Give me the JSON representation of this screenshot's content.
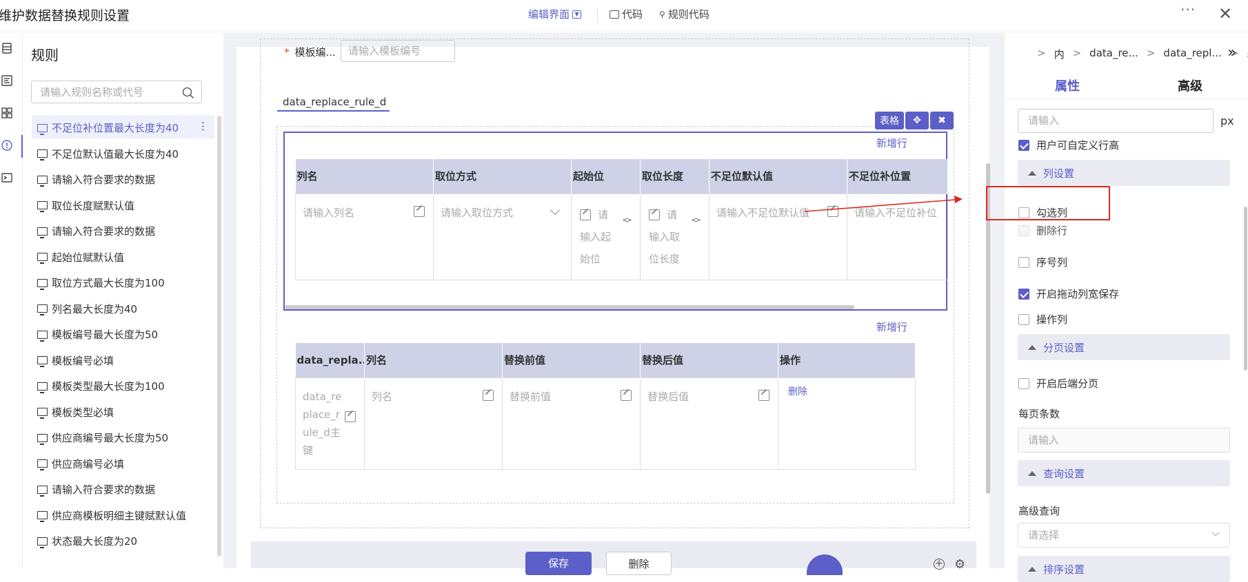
{
  "app": {
    "title": "维护数据替换规则设置",
    "nav": {
      "edit_ui": "编辑界面",
      "code": "代码",
      "rule_code": "规则代码"
    }
  },
  "rules_panel": {
    "title": "规则",
    "search_placeholder": "请输入规则名称或代号",
    "items": [
      "不足位补位置最大长度为40",
      "不足位默认值最大长度为40",
      "请输入符合要求的数据",
      "取位长度赋默认值",
      "请输入符合要求的数据",
      "起始位赋默认值",
      "取位方式最大长度为100",
      "列名最大长度为40",
      "模板编号最大长度为50",
      "模板编号必填",
      "模板类型最大长度为100",
      "模板类型必填",
      "供应商编号最大长度为50",
      "供应商编号必填",
      "请输入符合要求的数据",
      "供应商模板明细主键赋默认值",
      "状态最大长度为20"
    ],
    "selected_index": 0
  },
  "form": {
    "template_no_label": "模板编...",
    "template_no_placeholder": "请输入模板编号",
    "required_mark": "*",
    "tab_label": "data_replace_rule_d"
  },
  "widget_tags": {
    "table": "表格",
    "move": "✥",
    "close": "✖"
  },
  "table1": {
    "add_row": "新增行",
    "headers": [
      "列名",
      "取位方式",
      "起始位",
      "取位长度",
      "不足位默认值",
      "不足位补位置"
    ],
    "placeholders": [
      "请输入列名",
      "请输入取位方式",
      "请输入起始位",
      "请输入取位长度",
      "请输入不足位默认值",
      "请输入不足位补位"
    ]
  },
  "table2": {
    "add_row": "新增行",
    "headers": [
      "data_repla...",
      "列名",
      "替换前值",
      "替换后值",
      "操作"
    ],
    "cells": [
      "data_replace_rule_d主键",
      "列名",
      "替换前值",
      "替换后值"
    ],
    "delete_link": "删除"
  },
  "footer": {
    "save": "保存",
    "delete": "删除"
  },
  "props": {
    "breadcrumbs": [
      "内",
      "data_re...",
      "data_repl...",
      "表"
    ],
    "tab_attr": "属性",
    "tab_advanced": "高级",
    "row_height_placeholder": "请输入",
    "unit": "px",
    "custom_row_height": {
      "label": "用户可自定义行高",
      "checked": true
    },
    "column_section": "列设置",
    "checkbox_column": {
      "label": "勾选列",
      "checked": false
    },
    "delete_row": {
      "label": "删除行",
      "checked": false
    },
    "index_column": {
      "label": "序号列",
      "checked": false
    },
    "drag_width_save": {
      "label": "开启拖动列宽保存",
      "checked": true
    },
    "action_column": {
      "label": "操作列",
      "checked": false
    },
    "pagination_section": "分页设置",
    "backend_paging": {
      "label": "开启后端分页",
      "checked": false
    },
    "page_size_label": "每页条数",
    "page_size_placeholder": "请输入",
    "query_section": "查询设置",
    "advanced_query_label": "高级查询",
    "advanced_query_placeholder": "请选择",
    "sort_section": "排序设置"
  },
  "colors": {
    "accent": "#5b5fc7",
    "annotation_red": "#e0261d",
    "header_bg": "#cfd2e6"
  }
}
